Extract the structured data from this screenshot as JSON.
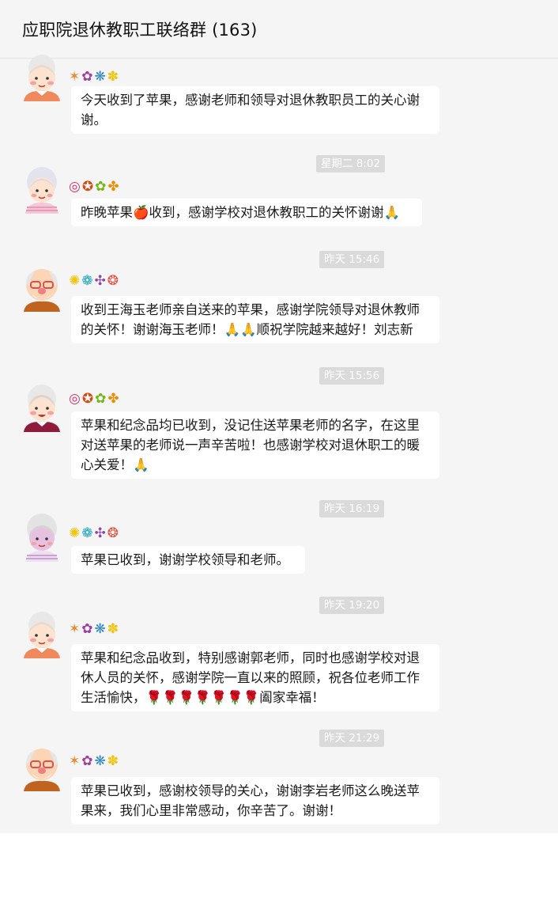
{
  "header": {
    "title": "应职院退休教职工联络群 (163)"
  },
  "messages": [
    {
      "time": "",
      "nick": [
        "✶",
        "✿",
        "❋",
        "✽"
      ],
      "nick_colors": [
        "#e88b2f",
        "#a13fa0",
        "#2e86c1",
        "#f1c40f"
      ],
      "avatar": "grandma-avatar",
      "text": "今天收到了苹果，感谢老师和领导对退休教职员工的关心谢谢。"
    },
    {
      "time": "星期二 8:02",
      "nick": [
        "◎",
        "✪",
        "✿",
        "✤"
      ],
      "nick_colors": [
        "#d6336c",
        "#d9480f",
        "#74b816",
        "#f08c00"
      ],
      "avatar": "grandma-avatar",
      "text": "昨晚苹果🍎收到，感谢学校对退休教职工的关怀谢谢🙏"
    },
    {
      "time": "昨天 15:46",
      "nick": [
        "✺",
        "❁",
        "✣",
        "❂"
      ],
      "nick_colors": [
        "#f1c40f",
        "#17a2b8",
        "#8e44ad",
        "#e74c3c"
      ],
      "avatar": "grandpa-avatar",
      "text": "收到王海玉老师亲自送来的苹果，感谢学院领导对退休教师的关怀！谢谢海玉老师！🙏🙏顺祝学院越来越好！刘志新"
    },
    {
      "time": "昨天 15:56",
      "nick": [
        "◎",
        "✪",
        "✿",
        "✤"
      ],
      "nick_colors": [
        "#d6336c",
        "#d9480f",
        "#74b816",
        "#f08c00"
      ],
      "avatar": "grandma-avatar",
      "text": "苹果和纪念品均已收到，没记住送苹果老师的名字，在这里对送苹果的老师说一声辛苦啦！也感谢学校对退休职工的暖心关爱！🙏"
    },
    {
      "time": "昨天 16:19",
      "nick": [
        "✺",
        "❁",
        "✣",
        "❂"
      ],
      "nick_colors": [
        "#f1c40f",
        "#17a2b8",
        "#8e44ad",
        "#e74c3c"
      ],
      "avatar": "grandma-avatar",
      "text": "苹果已收到，谢谢学校领导和老师。"
    },
    {
      "time": "昨天 19:20",
      "nick": [
        "✶",
        "✿",
        "❋",
        "✽"
      ],
      "nick_colors": [
        "#e88b2f",
        "#a13fa0",
        "#2e86c1",
        "#f1c40f"
      ],
      "avatar": "grandma-avatar",
      "text": "苹果和纪念品收到，特别感谢郭老师，同时也感谢学校对退休人员的关怀，感谢学院一直以来的照顾，祝各位老师工作生活愉快，🌹🌹🌹🌹🌹🌹🌹阖家幸福！"
    },
    {
      "time": "昨天 21:29",
      "nick": [
        "✶",
        "✿",
        "❋",
        "✽"
      ],
      "nick_colors": [
        "#e88b2f",
        "#a13fa0",
        "#2e86c1",
        "#f1c40f"
      ],
      "avatar": "grandpa-avatar",
      "text": "苹果已收到，感谢校领导的关心，谢谢李岩老师这么晚送苹果来，我们心里非常感动，你辛苦了。谢谢！"
    }
  ]
}
